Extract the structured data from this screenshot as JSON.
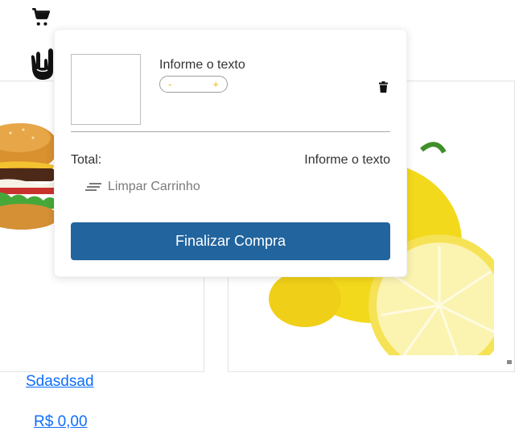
{
  "header": {
    "cart_icon": "shopping-cart-icon",
    "logo_icon": "rock-hand-logo"
  },
  "cart": {
    "item": {
      "name": "Informe o texto",
      "minus": "-",
      "plus": "+"
    },
    "total_label": "Total:",
    "total_value": "Informe o texto",
    "clear_label": "Limpar Carrinho",
    "checkout_label": "Finalizar Compra"
  },
  "products": [
    {
      "name": "Sdasdsad",
      "price": "R$ 0,00",
      "image": "hamburger"
    },
    {
      "image": "lemon"
    }
  ],
  "colors": {
    "checkout_bg": "#22649e",
    "stepper_accent": "#f2b705",
    "link": "#0d6efd"
  }
}
